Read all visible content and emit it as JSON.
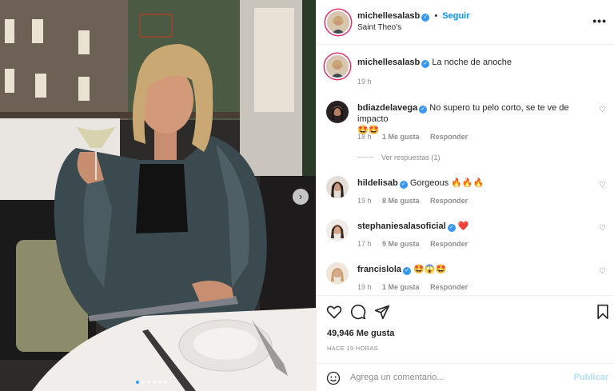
{
  "post": {
    "author": "michellesalasb",
    "follow_label": "Seguir",
    "location": "Saint Theo's",
    "more_label": "•••"
  },
  "caption": {
    "username": "michellesalasb",
    "text": "La noche de anoche",
    "time": "19 h"
  },
  "comments": [
    {
      "username": "bdiazdelavega",
      "text": "No supero tu pelo corto, se te ve de impacto",
      "emoji": "🤩🤩",
      "time": "18 h",
      "likes": "1 Me gusta",
      "reply": "Responder",
      "view_replies": "Ver respuestas (1)"
    },
    {
      "username": "hildelisab",
      "text": "Gorgeous",
      "emoji": "🔥🔥🔥",
      "time": "19 h",
      "likes": "8 Me gusta",
      "reply": "Responder"
    },
    {
      "username": "stephaniesalasoficial",
      "text": "",
      "emoji": "❤️",
      "time": "17 h",
      "likes": "9 Me gusta",
      "reply": "Responder"
    },
    {
      "username": "francislola",
      "text": "",
      "emoji": "🤩😱🤩",
      "time": "19 h",
      "likes": "1 Me gusta",
      "reply": "Responder"
    }
  ],
  "stats": {
    "likes": "49,946 Me gusta",
    "posted": "HACE 19 HORAS"
  },
  "add_comment": {
    "placeholder": "Agrega un comentario...",
    "publish": "Publicar"
  },
  "colors": {
    "link": "#0095f6",
    "muted": "#8e8e8e",
    "publish_disabled": "#b2dffc",
    "verified": "#3897f0"
  }
}
